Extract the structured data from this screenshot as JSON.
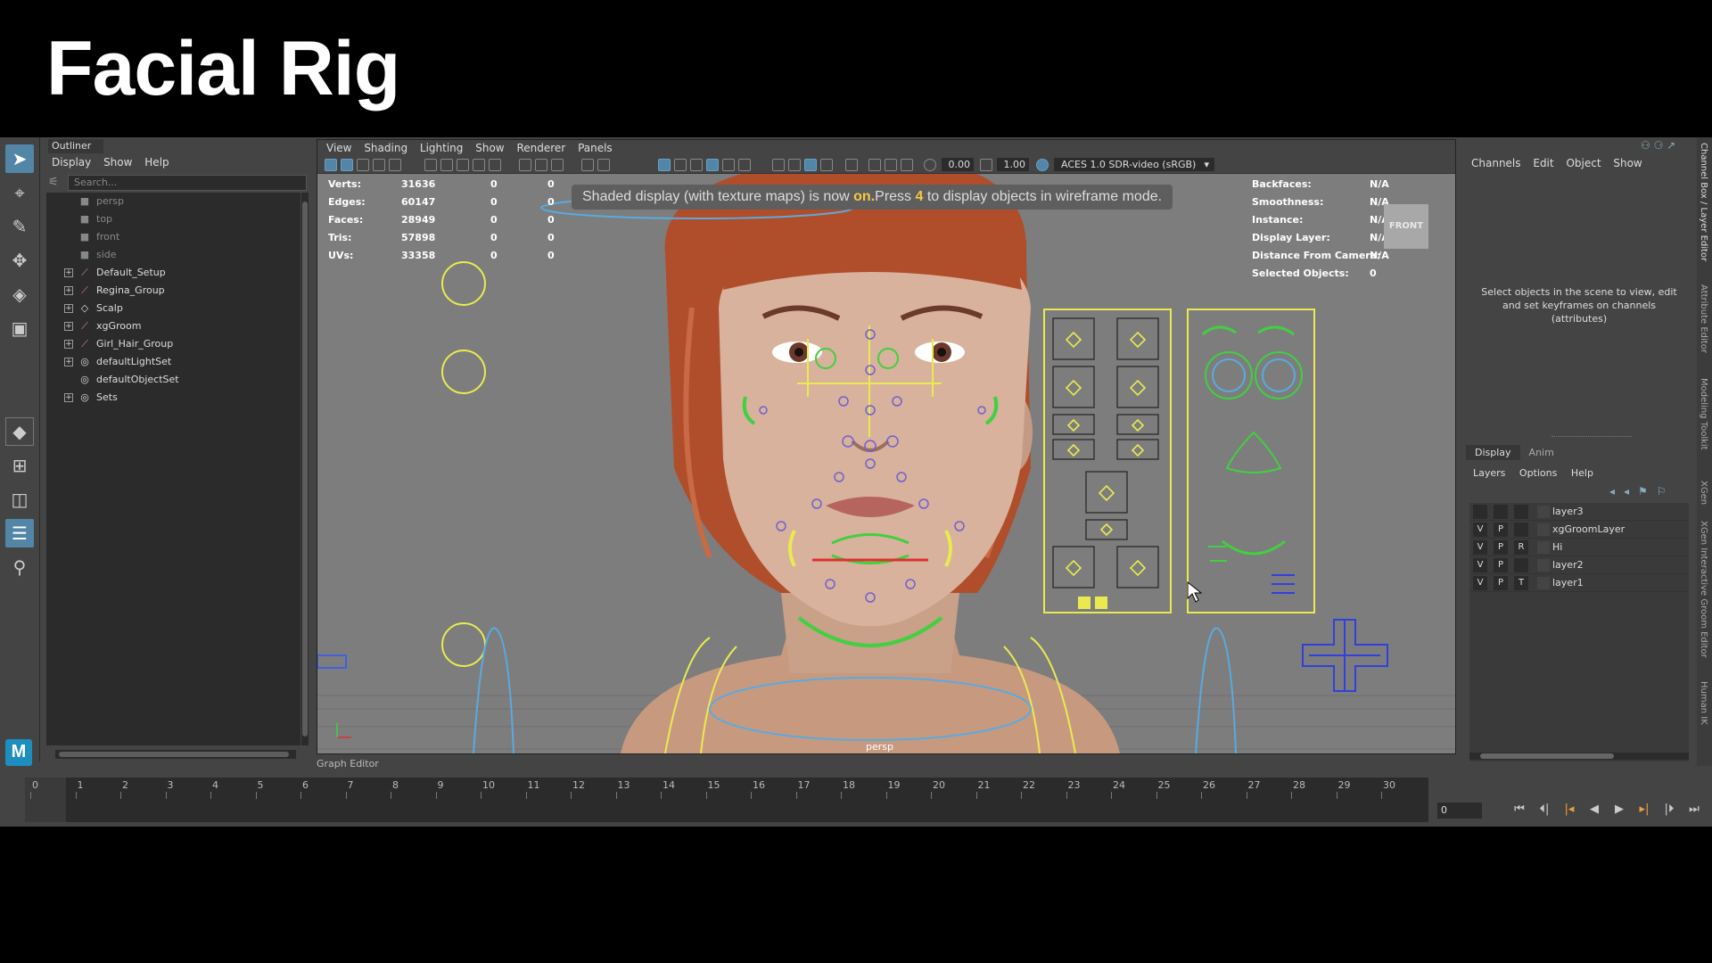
{
  "slide_title": "Facial Rig",
  "outliner": {
    "tab": "Outliner",
    "menu": [
      "Display",
      "Show",
      "Help"
    ],
    "search_placeholder": "Search...",
    "items": [
      {
        "label": "persp",
        "type": "camera"
      },
      {
        "label": "top",
        "type": "camera"
      },
      {
        "label": "front",
        "type": "camera"
      },
      {
        "label": "side",
        "type": "camera"
      },
      {
        "label": "Default_Setup",
        "type": "group"
      },
      {
        "label": "Regina_Group",
        "type": "group"
      },
      {
        "label": "Scalp",
        "type": "mesh"
      },
      {
        "label": "xgGroom",
        "type": "group"
      },
      {
        "label": "Girl_Hair_Group",
        "type": "group"
      },
      {
        "label": "defaultLightSet",
        "type": "set"
      },
      {
        "label": "defaultObjectSet",
        "type": "set"
      },
      {
        "label": "Sets",
        "type": "set"
      }
    ]
  },
  "viewport": {
    "menu": [
      "View",
      "Shading",
      "Lighting",
      "Show",
      "Renderer",
      "Panels"
    ],
    "field1": "0.00",
    "field2": "1.00",
    "colorspace": "ACES 1.0 SDR-video (sRGB)",
    "message_pre": "Shaded display (with texture maps) is now ",
    "message_on": "on.",
    "message_mid": "Press ",
    "message_key": "4",
    "message_post": " to display objects in wireframe mode.",
    "camera_label": "persp",
    "view_cube": "FRONT",
    "stats": [
      {
        "label": "Verts:",
        "v1": "31636",
        "v2": "0",
        "v3": "0"
      },
      {
        "label": "Edges:",
        "v1": "60147",
        "v2": "0",
        "v3": "0"
      },
      {
        "label": "Faces:",
        "v1": "28949",
        "v2": "0",
        "v3": "0"
      },
      {
        "label": "Tris:",
        "v1": "57898",
        "v2": "0",
        "v3": "0"
      },
      {
        "label": "UVs:",
        "v1": "33358",
        "v2": "0",
        "v3": "0"
      }
    ],
    "info": [
      {
        "label": "Backfaces:",
        "value": "N/A"
      },
      {
        "label": "Smoothness:",
        "value": "N/A"
      },
      {
        "label": "Instance:",
        "value": "N/A"
      },
      {
        "label": "Display Layer:",
        "value": "N/A"
      },
      {
        "label": "Distance From Camera:",
        "value": "N/A"
      },
      {
        "label": "Selected Objects:",
        "value": "0"
      }
    ]
  },
  "channel_box": {
    "menu": [
      "Channels",
      "Edit",
      "Object",
      "Show"
    ],
    "info": "Select objects in the scene to view, edit and set keyframes on channels (attributes)",
    "layer_tabs": [
      "Display",
      "Anim"
    ],
    "layer_menu": [
      "Layers",
      "Options",
      "Help"
    ],
    "layers": [
      {
        "v": "",
        "p": "",
        "r": "",
        "name": "layer3"
      },
      {
        "v": "V",
        "p": "P",
        "r": "",
        "name": "xgGroomLayer"
      },
      {
        "v": "V",
        "p": "P",
        "r": "R",
        "name": "Hi"
      },
      {
        "v": "V",
        "p": "P",
        "r": "",
        "name": "layer2"
      },
      {
        "v": "V",
        "p": "P",
        "r": "T",
        "name": "layer1"
      }
    ],
    "side_tabs": [
      "Channel Box / Layer Editor",
      "Attribute Editor",
      "Modeling Toolkit",
      "XGen",
      "XGen Interactive Groom Editor",
      "Human IK"
    ]
  },
  "graph_editor_label": "Graph Editor",
  "timeline": {
    "ticks": [
      "0",
      "1",
      "2",
      "3",
      "4",
      "5",
      "6",
      "7",
      "8",
      "9",
      "10",
      "11",
      "12",
      "13",
      "14",
      "15",
      "16",
      "17",
      "18",
      "19",
      "20",
      "21",
      "22",
      "23",
      "24",
      "25",
      "26",
      "27",
      "28",
      "29",
      "30"
    ],
    "current_frame": "0"
  }
}
